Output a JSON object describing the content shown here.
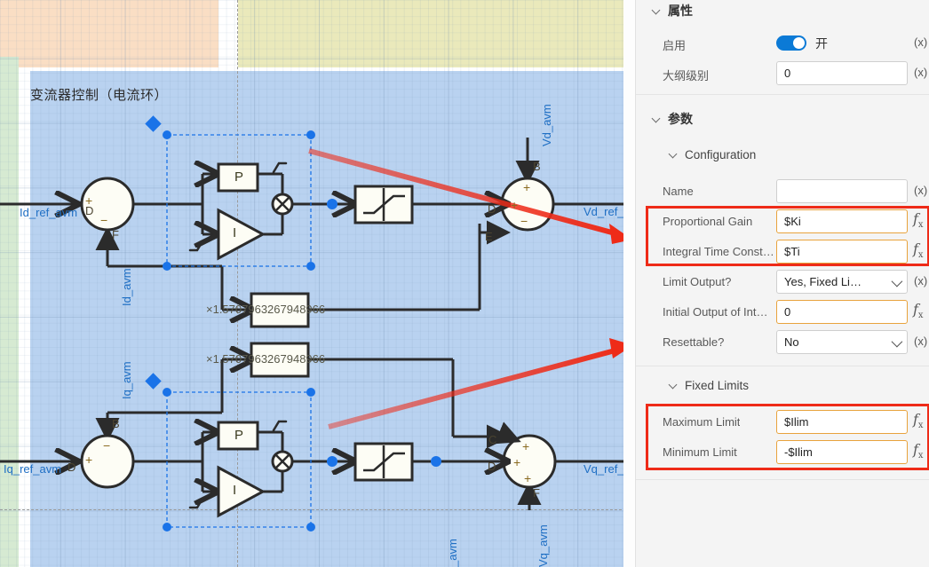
{
  "canvas": {
    "diagram_title": "变流器控制（电流环）",
    "blocks": {
      "p_label": "P",
      "i_label": "I",
      "gain_text": "×1.5707963267948966"
    },
    "port_labels": {
      "id_ref_avm": "Id_ref_avm",
      "iq_ref_avm": "Iq_ref_avm",
      "id_avm": "Id_avm",
      "iq_avm": "Iq_avm",
      "vd_avm": "Vd_avm",
      "vq_avm": "Vq_avm",
      "vd_ref": "Vd_ref_",
      "vq_ref": "Vq_ref_",
      "avm_partial": "_avm"
    },
    "terminals": {
      "t1": "D",
      "t2": "F",
      "t3": "B",
      "t4": "D",
      "t5": "E",
      "t6": "B",
      "t7": "D",
      "t8": "C",
      "t9": "D",
      "t10": "F"
    },
    "signs": {
      "plus": "+",
      "minus": "−"
    },
    "colors": {
      "region_blue": "#b9d2f0",
      "region_green": "#d6ead2",
      "region_orange": "#fadec4",
      "region_yellow": "#eae9bb",
      "wire": "#2b2b2b",
      "port_text": "#1f6fc4",
      "selection": "#1a73e8",
      "annotation_arrow": "#ee2B18"
    }
  },
  "panel": {
    "properties": {
      "title": "属性",
      "rows": [
        {
          "label": "启用",
          "value": "开",
          "suffix": "(x)",
          "type": "toggle",
          "toggle_on": true
        },
        {
          "label": "大纲级别",
          "value": "0",
          "suffix": "(x)",
          "type": "text"
        }
      ]
    },
    "parameters": {
      "title": "参数",
      "groups": [
        {
          "title": "Configuration",
          "rows": [
            {
              "label": "Name",
              "value": "",
              "suffix": "(x)",
              "type": "text",
              "warn": false
            },
            {
              "label": "Proportional Gain",
              "value": "$Ki",
              "suffix": "fx",
              "type": "text",
              "warn": true
            },
            {
              "label": "Integral Time Const…",
              "value": "$Ti",
              "suffix": "fx",
              "type": "text",
              "warn": true
            },
            {
              "label": "Limit Output?",
              "value": "Yes, Fixed Li…",
              "suffix": "(x)",
              "type": "select",
              "warn": false
            },
            {
              "label": "Initial Output of Int…",
              "value": "0",
              "suffix": "fx",
              "type": "text",
              "warn": true
            },
            {
              "label": "Resettable?",
              "value": "No",
              "suffix": "(x)",
              "type": "select",
              "warn": false
            }
          ]
        },
        {
          "title": "Fixed Limits",
          "rows": [
            {
              "label": "Maximum Limit",
              "value": "$Ilim",
              "suffix": "fx",
              "type": "text",
              "warn": true
            },
            {
              "label": "Minimum Limit",
              "value": "-$Ilim",
              "suffix": "fx",
              "type": "text",
              "warn": true
            }
          ]
        }
      ]
    }
  }
}
